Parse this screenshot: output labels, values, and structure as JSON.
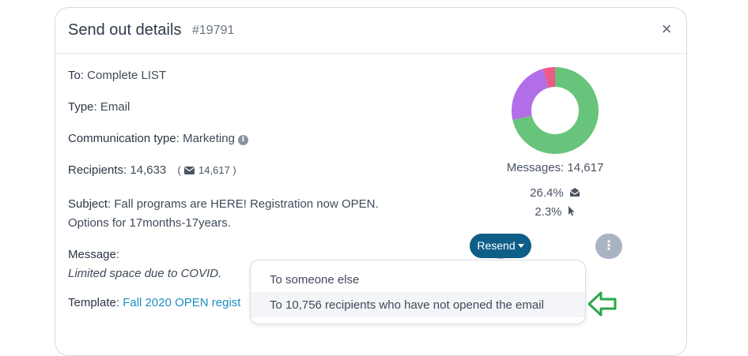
{
  "modal": {
    "title": "Send out details",
    "id": "#19791",
    "close": "×"
  },
  "details": {
    "to_label": "To",
    "to_value": ": Complete LIST",
    "type_label": "Type",
    "type_value": ": Email",
    "comm_label": "Communication type",
    "comm_value": ": Marketing",
    "info_icon": "i",
    "recipients_label": "Recipients",
    "recipients_value": ": 14,633",
    "recipients_sub_open": "(",
    "recipients_sub_value": "14,617",
    "recipients_sub_close": ")",
    "subject_label": "Subject",
    "subject_line1": ": Fall programs are HERE! Registration now OPEN.",
    "subject_line2": "Options for 17months-17years.",
    "message_label": "Message",
    "message_colon": ":",
    "message_value": "Limited space due to COVID.",
    "template_label": "Template",
    "template_colon": ": ",
    "template_value": "Fall 2020 OPEN regist"
  },
  "stats": {
    "messages": "Messages: 14,617",
    "open_rate": "26.4%",
    "click_rate": "2.3%"
  },
  "chart_data": {
    "type": "pie",
    "style": "donut",
    "slices": [
      {
        "value": 71.5,
        "color": "#68c47a"
      },
      {
        "value": 24.0,
        "color": "#b26ee8"
      },
      {
        "value": 4.5,
        "color": "#ec5a86"
      }
    ]
  },
  "actions": {
    "refresh_icon": "refresh-icon",
    "resend": "Resend",
    "more_icon": "⋮"
  },
  "dropdown": {
    "items": [
      {
        "label": "To someone else"
      },
      {
        "label": "To 10,756 recipients who have not opened the email"
      }
    ]
  },
  "colors": {
    "accent": "#0f5e87",
    "link": "#1a8fbf",
    "arrow": "#2aa84a"
  }
}
